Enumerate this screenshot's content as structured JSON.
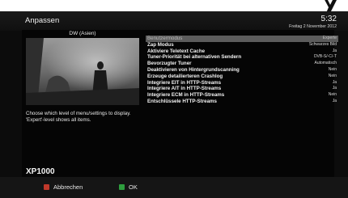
{
  "header": {
    "title": "Anpassen",
    "time": "5:32",
    "date": "Freitag  2 November 2012"
  },
  "preview": {
    "channel": "DW (Asien)"
  },
  "help_text": "Choose which level of menu/settings to display. 'Expert'-level shows all items.",
  "menu": {
    "items": [
      {
        "label": "Benutzermodus",
        "value": "Experte"
      },
      {
        "label": "Zap Modus",
        "value": "Schwarzes Bild"
      },
      {
        "label": "Aktiviere Teletext Cache",
        "value": "Ja"
      },
      {
        "label": "Tuner-Priorität bei alternativen Sendern",
        "value": "DVB-S/-C/-T"
      },
      {
        "label": "Bevorzugter Tuner",
        "value": "Automatisch"
      },
      {
        "label": "Deaktivieren von Hintergrundscanning",
        "value": "Nein"
      },
      {
        "label": "Erzeuge detailierteren Crashlog",
        "value": "Nein"
      },
      {
        "label": "Integriere EIT in HTTP-Streams",
        "value": "Ja"
      },
      {
        "label": "Integriere AIT in HTTP-Streams",
        "value": "Ja"
      },
      {
        "label": "Integriere ECM in HTTP-Streams",
        "value": "Nein"
      },
      {
        "label": "Entschlüssele HTTP-Streams",
        "value": "Ja"
      }
    ]
  },
  "model": "XP1000",
  "footer": {
    "cancel_label": "Abbrechen",
    "ok_label": "OK"
  },
  "colors": {
    "cancel_key": "#c0392b",
    "ok_key": "#2e9e3e"
  }
}
